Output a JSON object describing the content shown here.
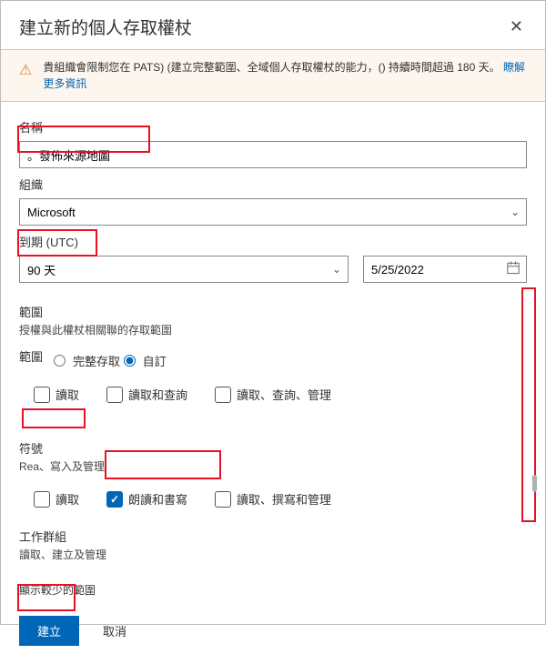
{
  "header": {
    "title": "建立新的個人存取權杖",
    "close_icon": "✕"
  },
  "warning": {
    "text_part1": "貴組織會限制您在 PATS) (建立完整範圍、全域個人存取權杖的能力，() 持續時間超過 180 天。",
    "link": "瞭解更多資訊"
  },
  "fields": {
    "name_label": "名稱",
    "name_value": "。發佈來源地圖",
    "org_label": "組織",
    "org_value": "Microsoft",
    "expiry_label": "到期 (UTC)",
    "expiry_select": "90 天",
    "expiry_date": "5/25/2022"
  },
  "scopes": {
    "label": "範圍",
    "sub": "授權與此權杖相關聯的存取範圍",
    "inline_label": "範圍",
    "full_label": "完整存取",
    "custom_label": "自訂",
    "row1": {
      "read": "讀取",
      "read_query": "讀取和查詢",
      "read_query_manage": "讀取、查詢、管理"
    },
    "symbols": {
      "title": "符號",
      "sub": "Rea、寫入及管理",
      "read": "讀取",
      "read_write": "朗讀和書寫",
      "read_write_manage": "讀取、撰寫和管理"
    },
    "workgroup": {
      "title": "工作群組",
      "sub": "讀取、建立及管理"
    },
    "show_fewer": "顯示較少的範圍"
  },
  "footer": {
    "create": "建立",
    "cancel": "取消"
  }
}
